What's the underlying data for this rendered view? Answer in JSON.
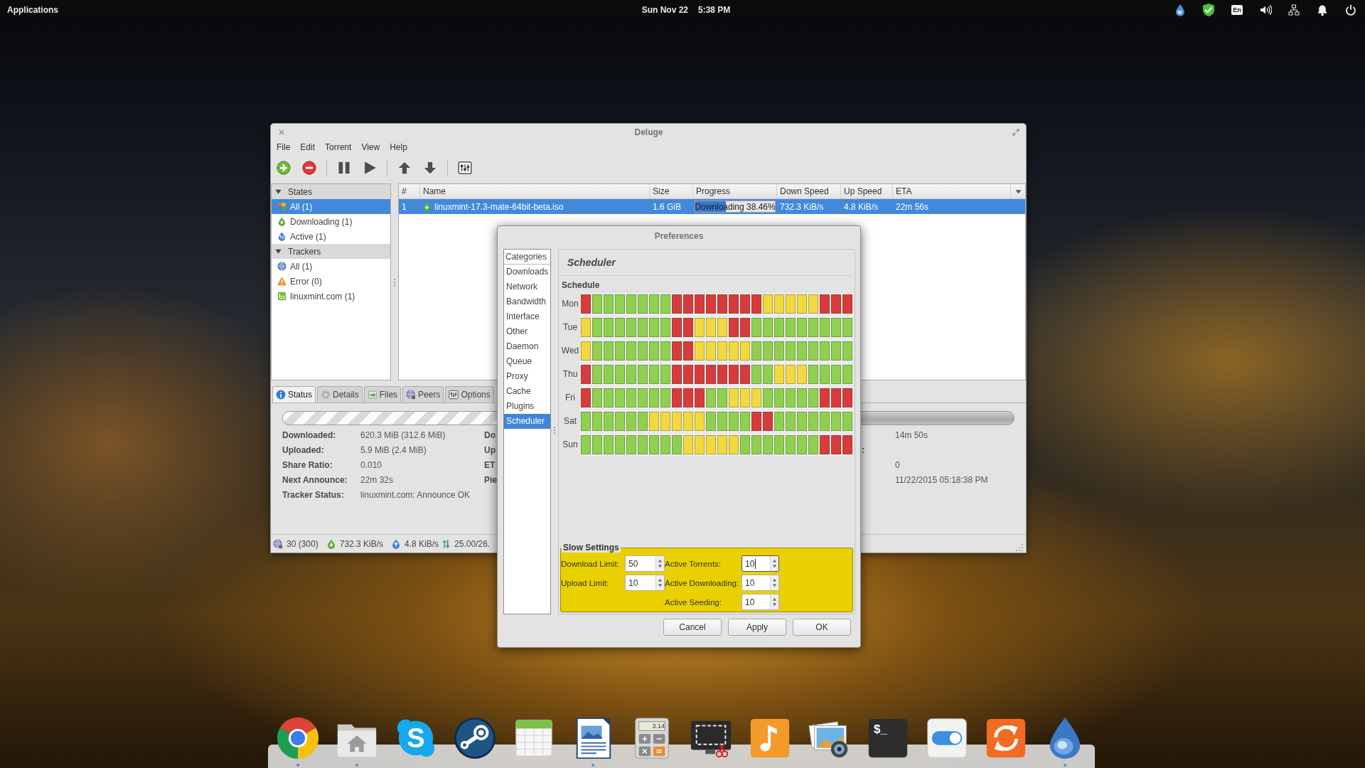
{
  "top_panel": {
    "menu": "Applications",
    "date": "Sun Nov 22",
    "time": "5:38 PM",
    "indicators": [
      {
        "kind": "deluge"
      },
      {
        "kind": "shield"
      },
      {
        "kind": "keyboard",
        "label": "En"
      },
      {
        "kind": "volume"
      },
      {
        "kind": "network"
      },
      {
        "kind": "notifications"
      },
      {
        "kind": "power"
      }
    ]
  },
  "deluge": {
    "title": "Deluge",
    "menu": [
      "File",
      "Edit",
      "Torrent",
      "View",
      "Help"
    ],
    "toolbar": [
      {
        "kind": "add"
      },
      {
        "kind": "remove"
      },
      {
        "kind": "separator"
      },
      {
        "kind": "pause"
      },
      {
        "kind": "resume"
      },
      {
        "kind": "separator"
      },
      {
        "kind": "queue_up"
      },
      {
        "kind": "queue_down"
      },
      {
        "kind": "separator"
      },
      {
        "kind": "preferences"
      }
    ],
    "sidebar": [
      {
        "label": "States",
        "expanded": true,
        "children": [
          {
            "label": "All (1)",
            "kind": "all",
            "selected": true
          },
          {
            "label": "Downloading (1)",
            "kind": "downloading",
            "selected": false
          },
          {
            "label": "Active (1)",
            "kind": "active",
            "selected": false
          }
        ]
      },
      {
        "label": "Trackers",
        "expanded": true,
        "children": [
          {
            "label": "All (1)",
            "kind": "all_trackers",
            "selected": false
          },
          {
            "label": "Error (0)",
            "kind": "error",
            "selected": false
          },
          {
            "label": "linuxmint.com (1)",
            "kind": "site",
            "selected": false
          }
        ]
      }
    ],
    "torrents": {
      "columns": [
        "#",
        "Name",
        "Size",
        "Progress",
        "Down Speed",
        "Up Speed",
        "ETA"
      ],
      "rows": [
        {
          "selected": true,
          "number": "1",
          "name": "linuxmint-17.3-mate-64bit-beta.iso",
          "size": "1.6 GiB",
          "progress": {
            "label": "Downloading 38.46%",
            "level": 0.3846
          },
          "down_speed": "732.3 KiB/s",
          "up_speed": "4.8 KiB/s",
          "eta": "22m 56s"
        }
      ]
    },
    "detail_tabs": [
      {
        "label": "Status",
        "kind": "info",
        "selected": true
      },
      {
        "label": "Details",
        "kind": "details",
        "selected": false
      },
      {
        "label": "Files",
        "kind": "files",
        "selected": false
      },
      {
        "label": "Peers",
        "kind": "peers",
        "selected": false
      },
      {
        "label": "Options",
        "kind": "options",
        "selected": false
      }
    ],
    "status": {
      "progress": {
        "level": 0.3846
      },
      "rows": [
        {
          "label": "Downloaded:",
          "value": "620.3 MiB (312.6 MiB)",
          "column_2": "Do",
          "column_3": "14m 50s"
        },
        {
          "label": "Uploaded:",
          "value": "5.9 MiB (2.4 MiB)",
          "column_2": "Up",
          "column_3_label": ":"
        },
        {
          "label": "Share Ratio:",
          "value": "0.010",
          "column_2": "ET",
          "column_3": "0"
        },
        {
          "label": "Next Announce:",
          "value": "22m 32s",
          "column_2": "Pie",
          "column_3": "11/22/2015 05:18:38 PM"
        },
        {
          "label": "Tracker Status:",
          "value": "linuxmint.com: Announce OK"
        }
      ]
    },
    "status_bar": [
      {
        "kind": "connections",
        "text": "30 (300)"
      },
      {
        "kind": "download",
        "text": "732.3 KiB/s"
      },
      {
        "kind": "upload",
        "text": "4.8 KiB/s"
      },
      {
        "kind": "protocol",
        "text": "25.00/26."
      }
    ]
  },
  "preferences": {
    "title": "Preferences",
    "categories_header": "Categories",
    "categories": [
      {
        "label": "Downloads",
        "selected": false
      },
      {
        "label": "Network",
        "selected": false
      },
      {
        "label": "Bandwidth",
        "selected": false
      },
      {
        "label": "Interface",
        "selected": false
      },
      {
        "label": "Other",
        "selected": false
      },
      {
        "label": "Daemon",
        "selected": false
      },
      {
        "label": "Queue",
        "selected": false
      },
      {
        "label": "Proxy",
        "selected": false
      },
      {
        "label": "Cache",
        "selected": false
      },
      {
        "label": "Plugins",
        "selected": false
      },
      {
        "label": "Scheduler",
        "selected": true
      }
    ],
    "page_title": "Scheduler",
    "schedule_title": "Schedule",
    "schedule": [
      {
        "day": "Mon",
        "cells": [
          {
            "color": "#d93b3b"
          },
          {
            "color": "#8fd14f"
          },
          {
            "color": "#8fd14f"
          },
          {
            "color": "#8fd14f"
          },
          {
            "color": "#8fd14f"
          },
          {
            "color": "#8fd14f"
          },
          {
            "color": "#8fd14f"
          },
          {
            "color": "#8fd14f"
          },
          {
            "color": "#d93b3b"
          },
          {
            "color": "#d93b3b"
          },
          {
            "color": "#d93b3b"
          },
          {
            "color": "#d93b3b"
          },
          {
            "color": "#d93b3b"
          },
          {
            "color": "#d93b3b"
          },
          {
            "color": "#d93b3b"
          },
          {
            "color": "#d93b3b"
          },
          {
            "color": "#f2d93e"
          },
          {
            "color": "#f2d93e"
          },
          {
            "color": "#f2d93e"
          },
          {
            "color": "#f2d93e"
          },
          {
            "color": "#f2d93e"
          },
          {
            "color": "#d93b3b"
          },
          {
            "color": "#d93b3b"
          },
          {
            "color": "#d93b3b"
          }
        ]
      },
      {
        "day": "Tue",
        "cells": [
          {
            "color": "#f2d93e"
          },
          {
            "color": "#8fd14f"
          },
          {
            "color": "#8fd14f"
          },
          {
            "color": "#8fd14f"
          },
          {
            "color": "#8fd14f"
          },
          {
            "color": "#8fd14f"
          },
          {
            "color": "#8fd14f"
          },
          {
            "color": "#8fd14f"
          },
          {
            "color": "#d93b3b"
          },
          {
            "color": "#d93b3b"
          },
          {
            "color": "#f2d93e"
          },
          {
            "color": "#f2d93e"
          },
          {
            "color": "#f2d93e"
          },
          {
            "color": "#d93b3b"
          },
          {
            "color": "#d93b3b"
          },
          {
            "color": "#8fd14f"
          },
          {
            "color": "#8fd14f"
          },
          {
            "color": "#8fd14f"
          },
          {
            "color": "#8fd14f"
          },
          {
            "color": "#8fd14f"
          },
          {
            "color": "#8fd14f"
          },
          {
            "color": "#8fd14f"
          },
          {
            "color": "#8fd14f"
          },
          {
            "color": "#8fd14f"
          }
        ]
      },
      {
        "day": "Wed",
        "cells": [
          {
            "color": "#f2d93e"
          },
          {
            "color": "#8fd14f"
          },
          {
            "color": "#8fd14f"
          },
          {
            "color": "#8fd14f"
          },
          {
            "color": "#8fd14f"
          },
          {
            "color": "#8fd14f"
          },
          {
            "color": "#8fd14f"
          },
          {
            "color": "#8fd14f"
          },
          {
            "color": "#d93b3b"
          },
          {
            "color": "#d93b3b"
          },
          {
            "color": "#f2d93e"
          },
          {
            "color": "#f2d93e"
          },
          {
            "color": "#f2d93e"
          },
          {
            "color": "#f2d93e"
          },
          {
            "color": "#f2d93e"
          },
          {
            "color": "#8fd14f"
          },
          {
            "color": "#8fd14f"
          },
          {
            "color": "#8fd14f"
          },
          {
            "color": "#8fd14f"
          },
          {
            "color": "#8fd14f"
          },
          {
            "color": "#8fd14f"
          },
          {
            "color": "#8fd14f"
          },
          {
            "color": "#8fd14f"
          },
          {
            "color": "#8fd14f"
          }
        ]
      },
      {
        "day": "Thu",
        "cells": [
          {
            "color": "#d93b3b"
          },
          {
            "color": "#8fd14f"
          },
          {
            "color": "#8fd14f"
          },
          {
            "color": "#8fd14f"
          },
          {
            "color": "#8fd14f"
          },
          {
            "color": "#8fd14f"
          },
          {
            "color": "#8fd14f"
          },
          {
            "color": "#8fd14f"
          },
          {
            "color": "#d93b3b"
          },
          {
            "color": "#d93b3b"
          },
          {
            "color": "#d93b3b"
          },
          {
            "color": "#d93b3b"
          },
          {
            "color": "#d93b3b"
          },
          {
            "color": "#d93b3b"
          },
          {
            "color": "#d93b3b"
          },
          {
            "color": "#8fd14f"
          },
          {
            "color": "#8fd14f"
          },
          {
            "color": "#f2d93e"
          },
          {
            "color": "#f2d93e"
          },
          {
            "color": "#f2d93e"
          },
          {
            "color": "#8fd14f"
          },
          {
            "color": "#8fd14f"
          },
          {
            "color": "#8fd14f"
          },
          {
            "color": "#8fd14f"
          }
        ]
      },
      {
        "day": "Fri",
        "cells": [
          {
            "color": "#d93b3b"
          },
          {
            "color": "#8fd14f"
          },
          {
            "color": "#8fd14f"
          },
          {
            "color": "#8fd14f"
          },
          {
            "color": "#8fd14f"
          },
          {
            "color": "#8fd14f"
          },
          {
            "color": "#8fd14f"
          },
          {
            "color": "#8fd14f"
          },
          {
            "color": "#d93b3b"
          },
          {
            "color": "#d93b3b"
          },
          {
            "color": "#d93b3b"
          },
          {
            "color": "#8fd14f"
          },
          {
            "color": "#8fd14f"
          },
          {
            "color": "#f2d93e"
          },
          {
            "color": "#f2d93e"
          },
          {
            "color": "#f2d93e"
          },
          {
            "color": "#8fd14f"
          },
          {
            "color": "#8fd14f"
          },
          {
            "color": "#8fd14f"
          },
          {
            "color": "#8fd14f"
          },
          {
            "color": "#8fd14f"
          },
          {
            "color": "#d93b3b"
          },
          {
            "color": "#d93b3b"
          },
          {
            "color": "#d93b3b"
          }
        ]
      },
      {
        "day": "Sat",
        "cells": [
          {
            "color": "#8fd14f"
          },
          {
            "color": "#8fd14f"
          },
          {
            "color": "#8fd14f"
          },
          {
            "color": "#8fd14f"
          },
          {
            "color": "#8fd14f"
          },
          {
            "color": "#8fd14f"
          },
          {
            "color": "#f2d93e"
          },
          {
            "color": "#f2d93e"
          },
          {
            "color": "#f2d93e"
          },
          {
            "color": "#f2d93e"
          },
          {
            "color": "#f2d93e"
          },
          {
            "color": "#8fd14f"
          },
          {
            "color": "#8fd14f"
          },
          {
            "color": "#8fd14f"
          },
          {
            "color": "#8fd14f"
          },
          {
            "color": "#d93b3b"
          },
          {
            "color": "#d93b3b"
          },
          {
            "color": "#8fd14f"
          },
          {
            "color": "#8fd14f"
          },
          {
            "color": "#8fd14f"
          },
          {
            "color": "#8fd14f"
          },
          {
            "color": "#8fd14f"
          },
          {
            "color": "#8fd14f"
          },
          {
            "color": "#8fd14f"
          }
        ]
      },
      {
        "day": "Sun",
        "cells": [
          {
            "color": "#8fd14f"
          },
          {
            "color": "#8fd14f"
          },
          {
            "color": "#8fd14f"
          },
          {
            "color": "#8fd14f"
          },
          {
            "color": "#8fd14f"
          },
          {
            "color": "#8fd14f"
          },
          {
            "color": "#8fd14f"
          },
          {
            "color": "#8fd14f"
          },
          {
            "color": "#8fd14f"
          },
          {
            "color": "#f2d93e"
          },
          {
            "color": "#f2d93e"
          },
          {
            "color": "#f2d93e"
          },
          {
            "color": "#f2d93e"
          },
          {
            "color": "#f2d93e"
          },
          {
            "color": "#8fd14f"
          },
          {
            "color": "#8fd14f"
          },
          {
            "color": "#8fd14f"
          },
          {
            "color": "#8fd14f"
          },
          {
            "color": "#8fd14f"
          },
          {
            "color": "#8fd14f"
          },
          {
            "color": "#8fd14f"
          },
          {
            "color": "#d93b3b"
          },
          {
            "color": "#d93b3b"
          },
          {
            "color": "#d93b3b"
          }
        ]
      }
    ],
    "slow_settings": {
      "title": "Slow Settings",
      "left_fields": [
        {
          "label": "Download Limit:",
          "value": "50",
          "focused": false
        },
        {
          "label": "Upload Limit:",
          "value": "10",
          "focused": false
        }
      ],
      "right_fields": [
        {
          "label": "Active Torrents:",
          "value": "10",
          "focused": true
        },
        {
          "label": "Active Downloading:",
          "value": "10",
          "focused": false
        },
        {
          "label": "Active Seeding:",
          "value": "10",
          "focused": false
        }
      ]
    },
    "buttons": [
      "Cancel",
      "Apply",
      "OK"
    ]
  },
  "dock": [
    {
      "kind": "browser",
      "running": true
    },
    {
      "kind": "files",
      "running": true
    },
    {
      "kind": "chat",
      "glyph": "S",
      "running": false
    },
    {
      "kind": "game",
      "running": false
    },
    {
      "kind": "calendar",
      "running": false
    },
    {
      "kind": "writer",
      "running": true
    },
    {
      "kind": "calculator",
      "display": "3.14",
      "running": false
    },
    {
      "kind": "screenshot",
      "running": false
    },
    {
      "kind": "music",
      "running": false
    },
    {
      "kind": "photos",
      "running": false
    },
    {
      "kind": "terminal",
      "glyph": "$_",
      "running": false
    },
    {
      "kind": "settings",
      "running": false
    },
    {
      "kind": "sync",
      "running": false
    },
    {
      "kind": "deluge",
      "running": true
    }
  ]
}
